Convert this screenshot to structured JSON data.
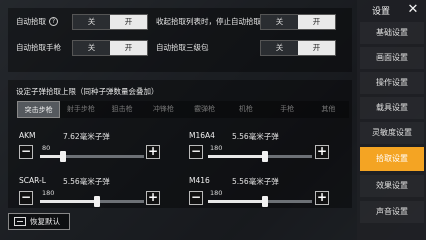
{
  "top": {
    "auto_pickup": {
      "label": "自动拾取",
      "off": "关",
      "on": "开"
    },
    "stop_when_list_open": {
      "label": "收起拾取列表时，停止自动拾取",
      "off": "关",
      "on": "开"
    },
    "auto_pickup_pistol": {
      "label": "自动拾取手枪",
      "off": "关",
      "on": "开"
    },
    "auto_pickup_lv3_backpack": {
      "label": "自动拾取三级包",
      "off": "关",
      "on": "开"
    }
  },
  "ammo": {
    "title": "设定子弹拾取上限（同种子弹数量会叠加）",
    "tabs": [
      "突击步枪",
      "射手步枪",
      "狙击枪",
      "冲锋枪",
      "霰弹枪",
      "机枪",
      "手枪",
      "其他"
    ],
    "items": [
      {
        "weapon": "AKM",
        "type": "7.62毫米子弹",
        "value": "80",
        "fraction": 0.22
      },
      {
        "weapon": "M16A4",
        "type": "5.56毫米子弹",
        "value": "180",
        "fraction": 0.55
      },
      {
        "weapon": "SCAR-L",
        "type": "5.56毫米子弹",
        "value": "180",
        "fraction": 0.55
      },
      {
        "weapon": "M416",
        "type": "5.56毫米子弹",
        "value": "180",
        "fraction": 0.55
      }
    ]
  },
  "reset_label": "恢复默认",
  "sidebar": {
    "title": "设置",
    "items": [
      {
        "label": "基础设置",
        "active": false
      },
      {
        "label": "画面设置",
        "active": false
      },
      {
        "label": "操作设置",
        "active": false
      },
      {
        "label": "载具设置",
        "active": false
      },
      {
        "label": "灵敏度设置",
        "active": false
      },
      {
        "label": "拾取设置",
        "active": true
      },
      {
        "label": "效果设置",
        "active": false
      },
      {
        "label": "声音设置",
        "active": false
      }
    ]
  },
  "colors": {
    "accent": "#f4a423"
  }
}
